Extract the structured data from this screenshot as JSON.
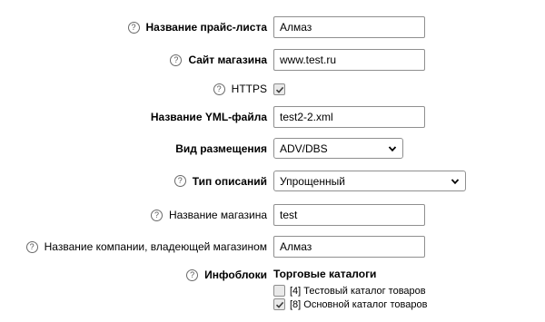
{
  "form": {
    "price_list_name": {
      "label": "Название прайс-листа",
      "value": "Алмаз"
    },
    "shop_site": {
      "label": "Сайт магазина",
      "value": "www.test.ru"
    },
    "https": {
      "label": "HTTPS",
      "checked": true
    },
    "yml_file_name": {
      "label": "Название YML-файла",
      "value": "test2-2.xml"
    },
    "placement_type": {
      "label": "Вид размещения",
      "selected": "ADV/DBS"
    },
    "description_type": {
      "label": "Тип описаний",
      "selected": "Упрощенный"
    },
    "shop_name": {
      "label": "Название магазина",
      "value": "test"
    },
    "company_name": {
      "label": "Название компании, владеющей магазином",
      "value": "Алмаз"
    },
    "iblocks": {
      "label": "Инфоблоки",
      "group_title": "Торговые каталоги",
      "items": [
        {
          "label": "[4] Тестовый каталог товаров",
          "checked": false
        },
        {
          "label": "[8] Основной каталог товаров",
          "checked": true
        }
      ]
    }
  },
  "help_glyph": "?"
}
